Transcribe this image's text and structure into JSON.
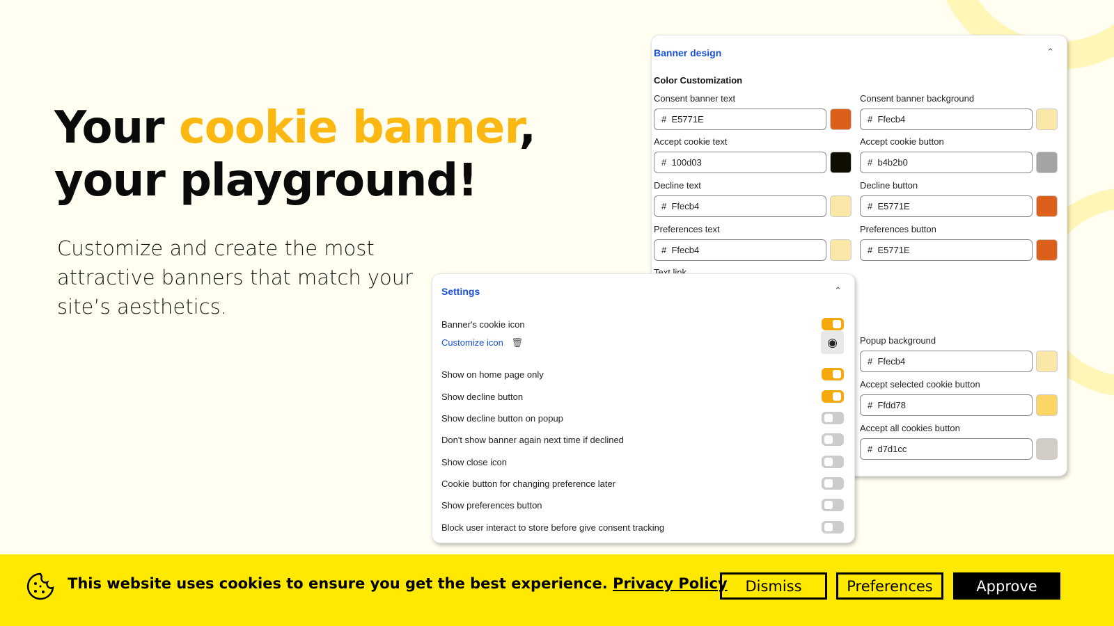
{
  "hero": {
    "title_pre": "Your ",
    "title_highlight": "cookie banner",
    "title_post": ",",
    "title_line2": "your playground!",
    "subtitle": "Customize and create the most attractive banners that match your site’s aesthetics.",
    "highlight_color": "#fbb812"
  },
  "banner_design": {
    "title": "Banner design",
    "section": "Color Customization",
    "partial_label": "Text link",
    "fields": [
      {
        "label": "Consent banner text",
        "value": "E5771E",
        "color": "#dc5f1a"
      },
      {
        "label": "Consent banner background",
        "value": "Ffecb4",
        "color": "#fbe7a8"
      },
      {
        "label": "Accept cookie text",
        "value": "100d03",
        "color": "#100d03"
      },
      {
        "label": "Accept cookie button",
        "value": "b4b2b0",
        "color": "#a4a4a4"
      },
      {
        "label": "Decline text",
        "value": "Ffecb4",
        "color": "#fbe7a8"
      },
      {
        "label": "Decline button",
        "value": "E5771E",
        "color": "#dc5f1a"
      },
      {
        "label": "Preferences text",
        "value": "Ffecb4",
        "color": "#fbe7a8"
      },
      {
        "label": "Preferences button",
        "value": "E5771E",
        "color": "#dc5f1a"
      },
      {
        "label": "Popup background",
        "value": "Ffecb4",
        "color": "#fbe7a8"
      },
      {
        "label": "Accept selected cookie button",
        "value": "Ffdd78",
        "color": "#fbd666"
      },
      {
        "label": "Accept all cookies button",
        "value": "d7d1cc",
        "color": "#d2ccc7"
      }
    ]
  },
  "settings": {
    "title": "Settings",
    "customize_icon": "Customize icon",
    "rows": [
      {
        "label": "Banner's cookie icon",
        "on": true
      },
      {
        "label": "Show on home page only",
        "on": true
      },
      {
        "label": "Show decline button",
        "on": true
      },
      {
        "label": "Show decline button on popup",
        "on": false
      },
      {
        "label": "Don't show banner again next time if declined",
        "on": false
      },
      {
        "label": "Show close icon",
        "on": false
      },
      {
        "label": "Cookie button for changing preference later",
        "on": false
      },
      {
        "label": "Show preferences button",
        "on": false
      },
      {
        "label": "Block user interact to store before give consent tracking",
        "on": false
      }
    ]
  },
  "cookie_bar": {
    "text": "This website uses cookies to ensure you get the best experience. ",
    "link": "Privacy Policy",
    "dismiss": "Dismiss",
    "preferences": "Preferences",
    "approve": "Approve",
    "background": "#ffe900"
  }
}
